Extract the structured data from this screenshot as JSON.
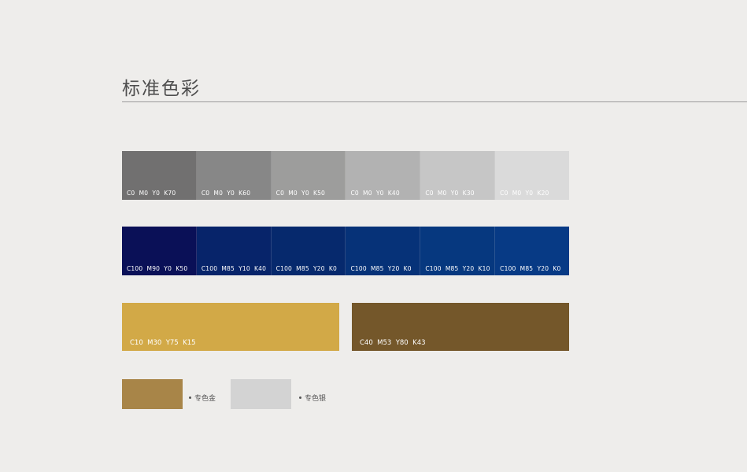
{
  "title": "标准色彩",
  "gray_row": [
    {
      "label": "C0  M0  Y0  K70",
      "color": "#717070"
    },
    {
      "label": "C0  M0  Y0  K60",
      "color": "#878787"
    },
    {
      "label": "C0  M0  Y0  K50",
      "color": "#9d9d9c"
    },
    {
      "label": "C0  M0  Y0  K40",
      "color": "#b2b2b2"
    },
    {
      "label": "C0  M0  Y0  K30",
      "color": "#c6c6c6"
    },
    {
      "label": "C0  M0  Y0  K20",
      "color": "#dadada"
    }
  ],
  "blue_row": [
    {
      "label": "C100  M90  Y0  K50",
      "color": "#0a1057"
    },
    {
      "label": "C100  M85  Y10  K40",
      "color": "#07246a"
    },
    {
      "label": "C100  M85  Y20  K0",
      "color": "#06296d"
    },
    {
      "label": "C100  M85  Y20  K0",
      "color": "#063278"
    },
    {
      "label": "C100  M85  Y20  K10",
      "color": "#06387f"
    },
    {
      "label": "C100  M85  Y20  K0",
      "color": "#073a85"
    }
  ],
  "big_swatches": [
    {
      "label": "C10  M30  Y75  K15",
      "color": "#d2a947"
    },
    {
      "label": "C40  M53  Y80  K43",
      "color": "#74572a"
    }
  ],
  "spot_colors": [
    {
      "label": "专色金",
      "color": "#a88548"
    },
    {
      "label": "专色银",
      "color": "#d3d3d3"
    }
  ]
}
